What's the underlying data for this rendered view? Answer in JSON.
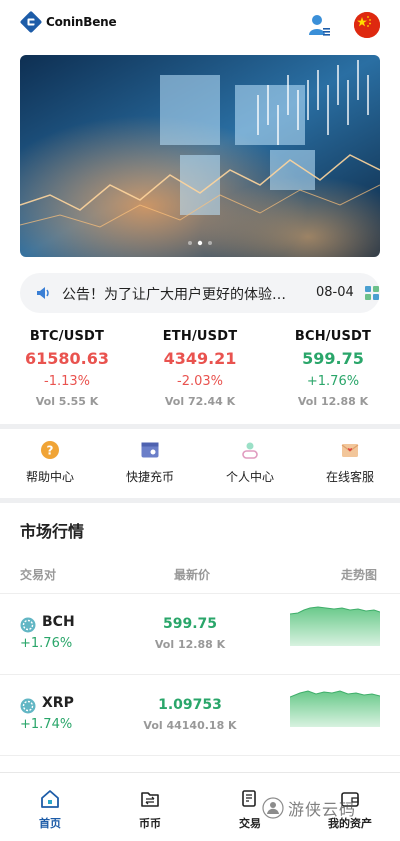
{
  "header": {
    "brand": "ConinBene",
    "icons": {
      "logo": "logo-icon",
      "user": "user-icon",
      "language": "china-flag-icon"
    },
    "brand_color": "#1d5ca8"
  },
  "notice": {
    "text": "公告！为了让广大用户更好的体验…",
    "date": "08-04",
    "icons": {
      "left": "speaker-icon",
      "right": "grid-icon"
    }
  },
  "tickers": [
    {
      "pair": "BTC/USDT",
      "price": "61580.63",
      "change": "-1.13%",
      "vol": "Vol 5.55 K",
      "trend": "down"
    },
    {
      "pair": "ETH/USDT",
      "price": "4349.21",
      "change": "-2.03%",
      "vol": "Vol 72.44 K",
      "trend": "down"
    },
    {
      "pair": "BCH/USDT",
      "price": "599.75",
      "change": "+1.76%",
      "vol": "Vol 12.88 K",
      "trend": "up"
    }
  ],
  "quick_links": [
    {
      "label": "帮助中心",
      "icon": "help-icon"
    },
    {
      "label": "快捷充币",
      "icon": "wallet-icon"
    },
    {
      "label": "个人中心",
      "icon": "profile-icon"
    },
    {
      "label": "在线客服",
      "icon": "mail-heart-icon"
    }
  ],
  "market": {
    "title": "市场行情",
    "columns": {
      "pair": "交易对",
      "price": "最新价",
      "trend": "走势图"
    },
    "rows": [
      {
        "coin": "BCH",
        "change": "+1.76%",
        "price": "599.75",
        "vol": "Vol 12.88 K",
        "trend": "up"
      },
      {
        "coin": "XRP",
        "change": "+1.74%",
        "price": "1.09753",
        "vol": "Vol 44140.18 K",
        "trend": "up"
      }
    ]
  },
  "tabs": [
    {
      "label": "首页",
      "icon": "home-icon",
      "active": true
    },
    {
      "label": "币币",
      "icon": "folder-swap-icon",
      "active": false
    },
    {
      "label": "交易",
      "icon": "document-icon",
      "active": false
    },
    {
      "label": "我的资产",
      "icon": "wallet-icon",
      "active": false
    }
  ],
  "watermark": {
    "text": "游侠云码"
  },
  "colors": {
    "up": "#2aa66a",
    "down": "#e9534f",
    "accent": "#1d5ca8",
    "divider": "#eeeff1"
  }
}
